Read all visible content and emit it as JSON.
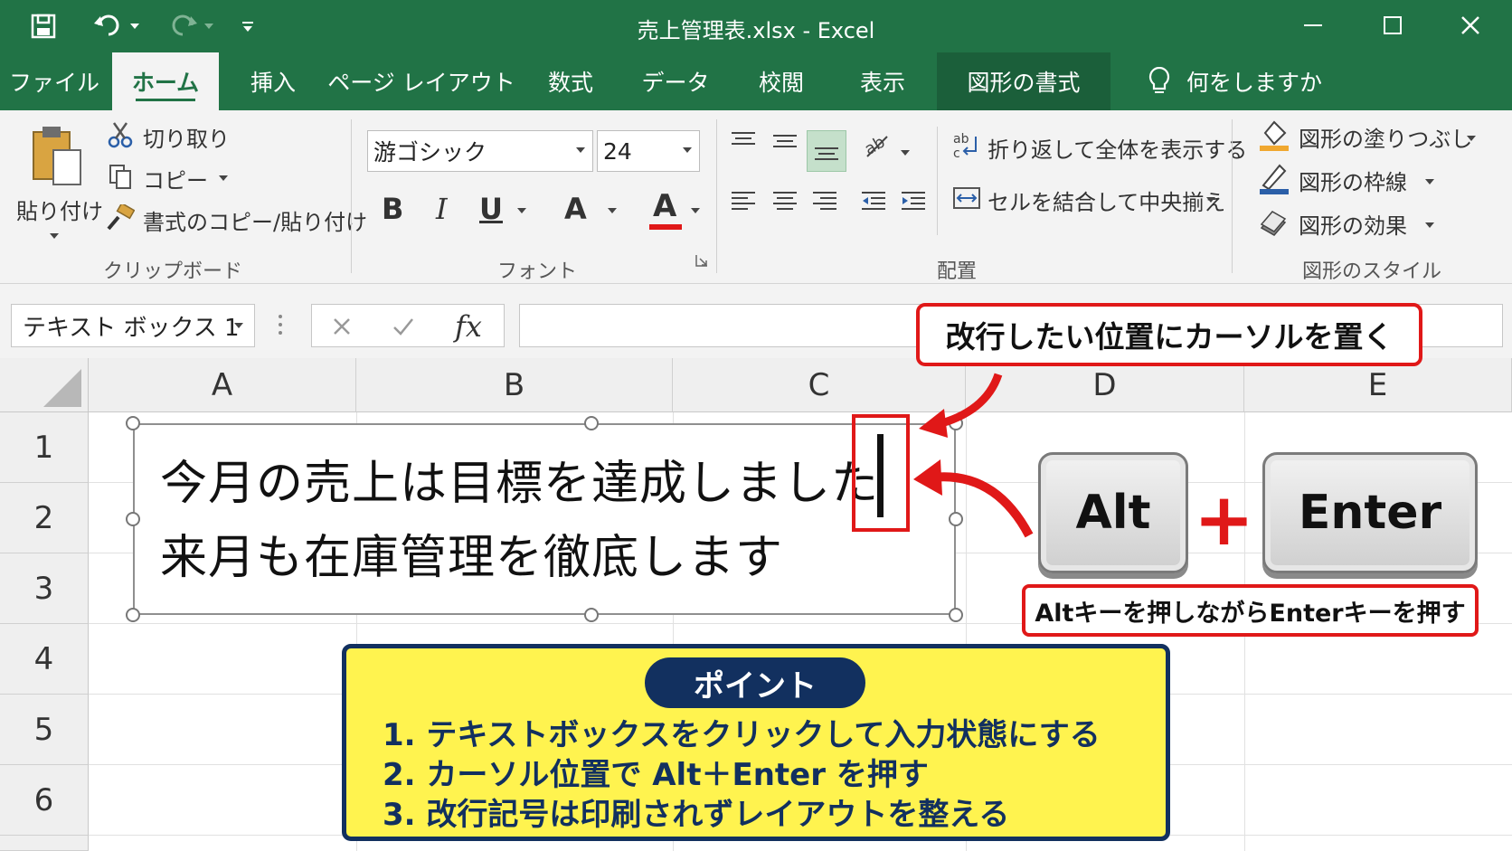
{
  "window": {
    "title": "売上管理表.xlsx  -  Excel"
  },
  "tabs": [
    {
      "label": "ファイル"
    },
    {
      "label": "ホーム"
    },
    {
      "label": "挿入"
    },
    {
      "label": "ページ レイアウト"
    },
    {
      "label": "数式"
    },
    {
      "label": "データ"
    },
    {
      "label": "校閲"
    },
    {
      "label": "表示"
    },
    {
      "label": "図形の書式"
    }
  ],
  "tell_me": "何をしますか",
  "clipboard": {
    "paste": "貼り付け",
    "cut": "切り取り",
    "copy": "コピー",
    "format_painter": "書式のコピー/貼り付け",
    "group_label": "クリップボード"
  },
  "font": {
    "name": "游ゴシック",
    "size": "24",
    "bold": "B",
    "italic": "I",
    "underline": "U",
    "font_color": "A",
    "group_label": "フォント"
  },
  "alignment": {
    "wrap_text": "折り返して全体を表示する",
    "merge_center": "セルを結合して中央揃え",
    "group_label": "配置"
  },
  "shape_styles": {
    "fill": "図形の塗りつぶし",
    "outline": "図形の枠線",
    "effects": "図形の効果",
    "group_label": "図形のスタイル"
  },
  "formula_bar": {
    "name_box": "テキスト ボックス 1",
    "fx": "fx"
  },
  "grid": {
    "columns": [
      "A",
      "B",
      "C",
      "D",
      "E"
    ],
    "rows": [
      "1",
      "2",
      "3",
      "4",
      "5",
      "6"
    ]
  },
  "textbox": {
    "line1": "今月の売上は目標を達成しました",
    "line2": "来月も在庫管理を徹底します"
  },
  "callouts": {
    "cursor_hint": "改行したい位置にカーソルを置く",
    "key_alt": "Alt",
    "plus": "+",
    "key_enter": "Enter",
    "key_hint": "Altキーを押しながらEnterキーを押す"
  },
  "point": {
    "title": "ポイント",
    "items": [
      "1. テキストボックスをクリックして入力状態にする",
      "2. カーソル位置で Alt＋Enter を押す",
      "3. 改行記号は印刷されずレイアウトを整える"
    ]
  },
  "colors": {
    "excel_green": "#217346",
    "callout_red": "#e01818",
    "point_yellow": "#fff34f",
    "point_navy": "#12305f"
  }
}
